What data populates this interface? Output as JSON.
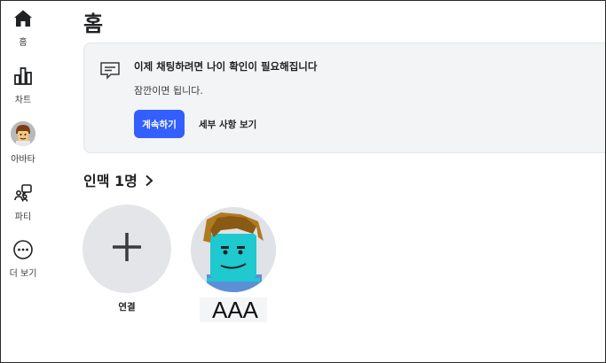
{
  "sidebar": {
    "items": [
      {
        "label": "홈",
        "icon": "home-icon"
      },
      {
        "label": "차트",
        "icon": "chart-icon"
      },
      {
        "label": "아바타",
        "icon": "avatar-icon"
      },
      {
        "label": "파티",
        "icon": "party-icon"
      },
      {
        "label": "더 보기",
        "icon": "more-icon"
      }
    ]
  },
  "page": {
    "title": "홈"
  },
  "notice": {
    "icon": "chat-icon",
    "title": "이제 채팅하려면 나이 확인이 필요해집니다",
    "subtitle": "잠깐이면 됩니다.",
    "primary_button": "계속하기",
    "secondary_button": "세부 사항 보기"
  },
  "connections": {
    "header": "인맥 1명",
    "add_label": "연결",
    "friends": [
      {
        "name": "AAA"
      }
    ]
  },
  "colors": {
    "accent": "#335fff",
    "card_bg": "#f2f4f5",
    "circle_bg": "#e3e5e9"
  }
}
